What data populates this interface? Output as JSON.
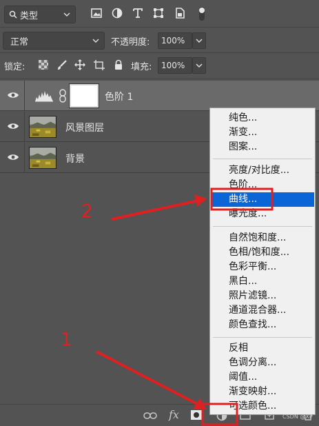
{
  "filter": {
    "label": "类型",
    "icon": "search-icon"
  },
  "filter_icons": [
    "image-filter-icon",
    "adjustment-filter-icon",
    "type-filter-icon",
    "shape-filter-icon",
    "smart-object-filter-icon",
    "filter-toggle-icon"
  ],
  "blend": {
    "mode": "正常"
  },
  "opacity": {
    "label": "不透明度:",
    "value": "100%"
  },
  "lock": {
    "label": "锁定:",
    "icons": [
      "lock-transparent-icon",
      "lock-brush-icon",
      "lock-position-icon",
      "lock-artboard-icon",
      "lock-all-icon"
    ]
  },
  "fill": {
    "label": "填充:",
    "value": "100%"
  },
  "layers": [
    {
      "name": "色阶 1",
      "type": "adjustment",
      "selected": true
    },
    {
      "name": "风景图层",
      "type": "image",
      "selected": false
    },
    {
      "name": "背景",
      "type": "image",
      "selected": false
    }
  ],
  "menu": {
    "groups": [
      [
        "纯色...",
        "渐变...",
        "图案..."
      ],
      [
        "亮度/对比度...",
        "色阶...",
        "曲线...",
        "曝光度..."
      ],
      [
        "自然饱和度...",
        "色相/饱和度...",
        "色彩平衡...",
        "黑白...",
        "照片滤镜...",
        "通道混合器...",
        "颜色查找..."
      ],
      [
        "反相",
        "色调分离...",
        "阈值...",
        "渐变映射...",
        "可选颜色..."
      ]
    ],
    "highlighted": "曲线..."
  },
  "bottom_icons": [
    "link-icon",
    "fx-icon",
    "mask-icon",
    "adjustment-layer-icon",
    "group-icon",
    "new-layer-icon",
    "trash-icon"
  ],
  "bottom": {
    "fx": "fx"
  },
  "annotations": {
    "step1": "1",
    "step2": "2"
  },
  "watermark": "CSDN @XP",
  "colors": {
    "accent": "#0a66d6",
    "annotation": "#e02020",
    "panel": "#535353",
    "menu_bg": "#f0f0f0"
  }
}
